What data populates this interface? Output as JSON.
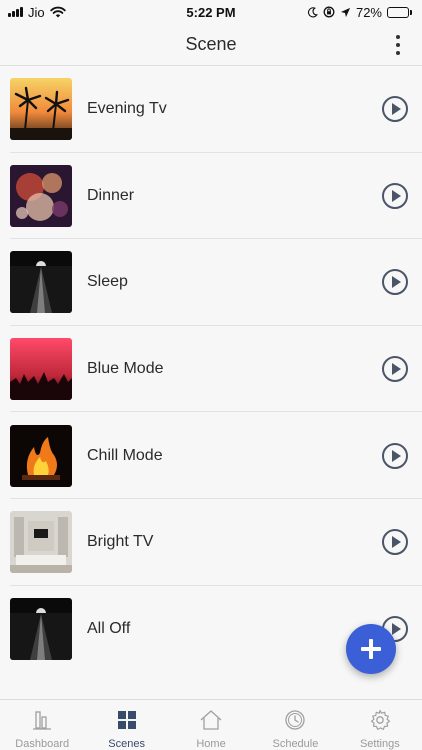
{
  "status_bar": {
    "carrier": "Jio",
    "time": "5:22 PM",
    "battery_percent": "72%",
    "battery_level": 0.72,
    "icons": [
      "signal-icon",
      "wifi-icon",
      "moon-icon",
      "rotation-lock-icon",
      "location-arrow-icon",
      "battery-icon"
    ]
  },
  "header": {
    "title": "Scene",
    "menu_icon": "kebab-menu-icon"
  },
  "scenes": [
    {
      "name": "Evening Tv",
      "thumbnail": "palm-sunset",
      "action_icon": "play-icon"
    },
    {
      "name": "Dinner",
      "thumbnail": "party-lights",
      "action_icon": "play-icon"
    },
    {
      "name": "Sleep",
      "thumbnail": "moon-over-sea",
      "action_icon": "play-icon"
    },
    {
      "name": "Blue Mode",
      "thumbnail": "concert-crowd",
      "action_icon": "play-icon"
    },
    {
      "name": "Chill Mode",
      "thumbnail": "fireplace",
      "action_icon": "play-icon"
    },
    {
      "name": "Bright TV",
      "thumbnail": "living-room",
      "action_icon": "play-icon"
    },
    {
      "name": "All Off",
      "thumbnail": "moon-over-sea",
      "action_icon": "play-icon"
    }
  ],
  "fab": {
    "icon": "plus-icon",
    "color": "#3b5fd6"
  },
  "tab_bar": {
    "tabs": [
      {
        "label": "Dashboard",
        "icon": "bar-chart-icon",
        "active": false
      },
      {
        "label": "Scenes",
        "icon": "grid-icon",
        "active": true
      },
      {
        "label": "Home",
        "icon": "house-icon",
        "active": false
      },
      {
        "label": "Schedule",
        "icon": "clock-icon",
        "active": false
      },
      {
        "label": "Settings",
        "icon": "gear-icon",
        "active": false
      }
    ]
  },
  "colors": {
    "background": "#f7f7f7",
    "accent": "#3b5fd6",
    "play_icon": "#4a5568",
    "active_tab": "#3a4a6b",
    "inactive_tab": "#9a9a9a"
  }
}
